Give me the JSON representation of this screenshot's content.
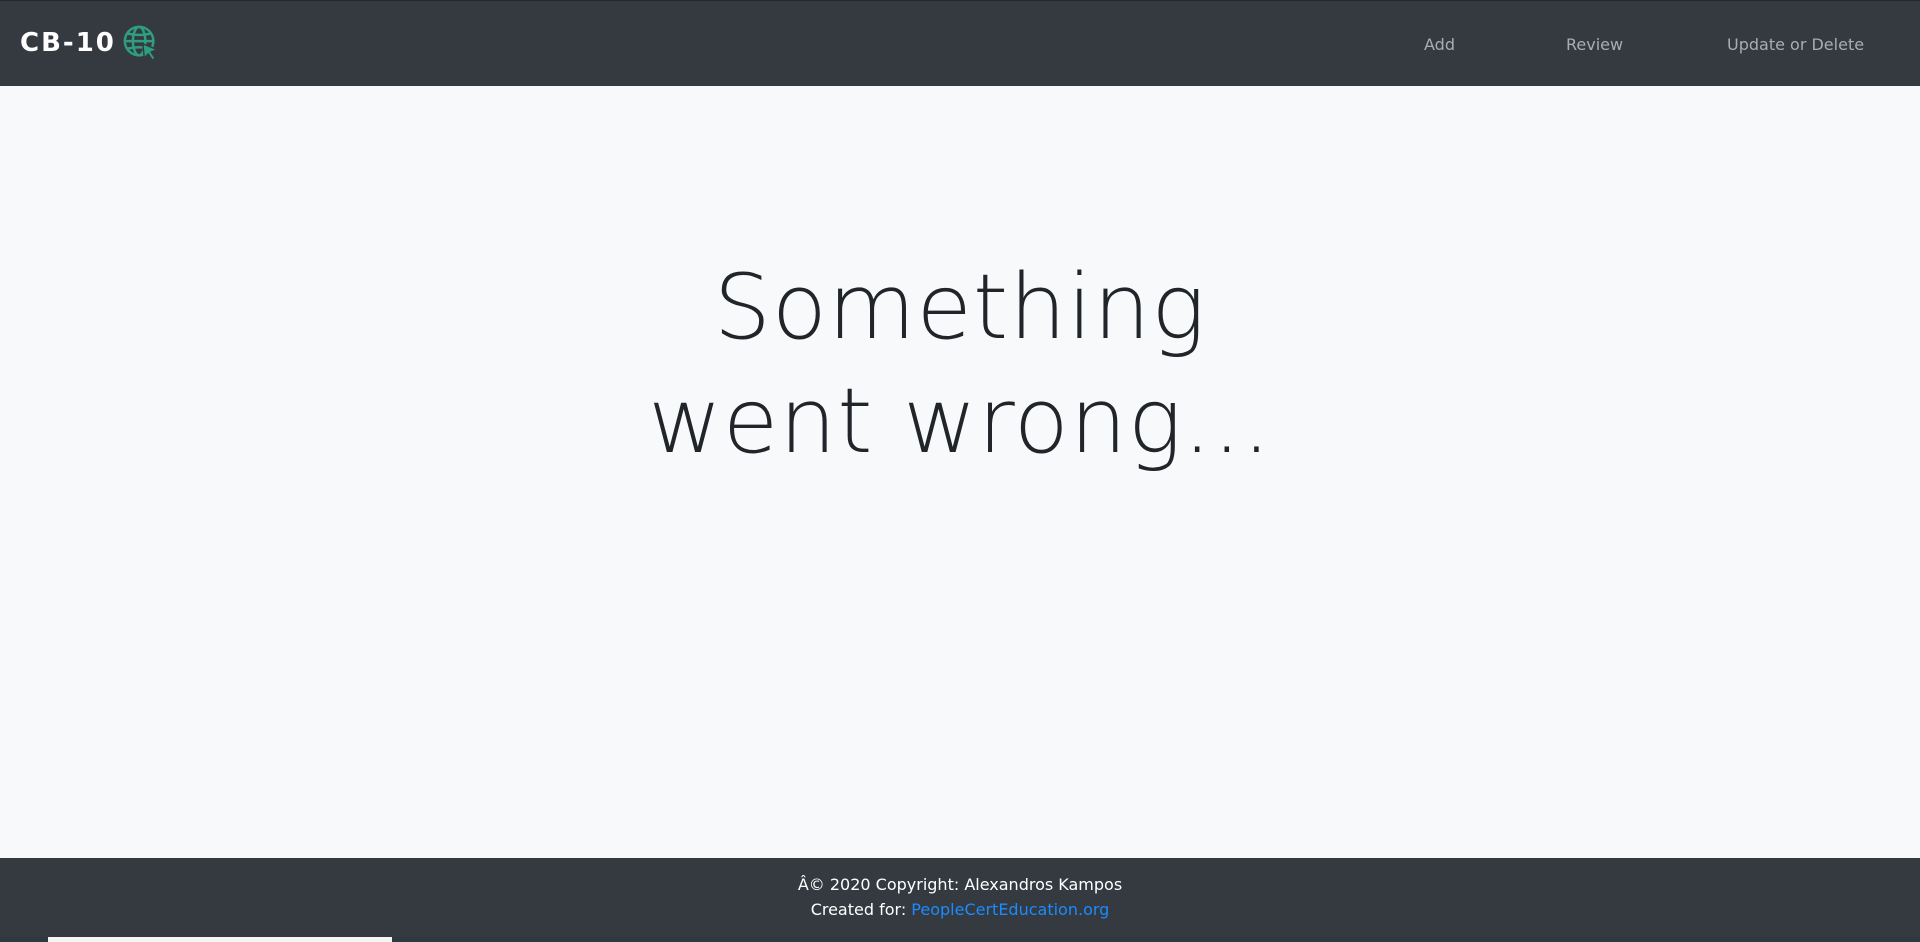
{
  "navbar": {
    "brand_text": "CB-10",
    "brand_icon": "globe-cursor-icon",
    "links": [
      {
        "label": "Add"
      },
      {
        "label": "Review"
      },
      {
        "label": "Update or Delete"
      }
    ]
  },
  "main": {
    "heading_line1": "Something",
    "heading_line2": "went wrong..."
  },
  "footer": {
    "copyright": "Â© 2020 Copyright: Alexandros Kampos",
    "created_for_label": "Created for:",
    "created_for_link": "PeopleCertEducation.org"
  },
  "colors": {
    "navbar_bg": "#343a40",
    "page_bg": "#f8f9fa",
    "brand_accent": "#2e9e7e",
    "link_color": "#1a8cff",
    "nav_link_color": "#a9adb2"
  }
}
